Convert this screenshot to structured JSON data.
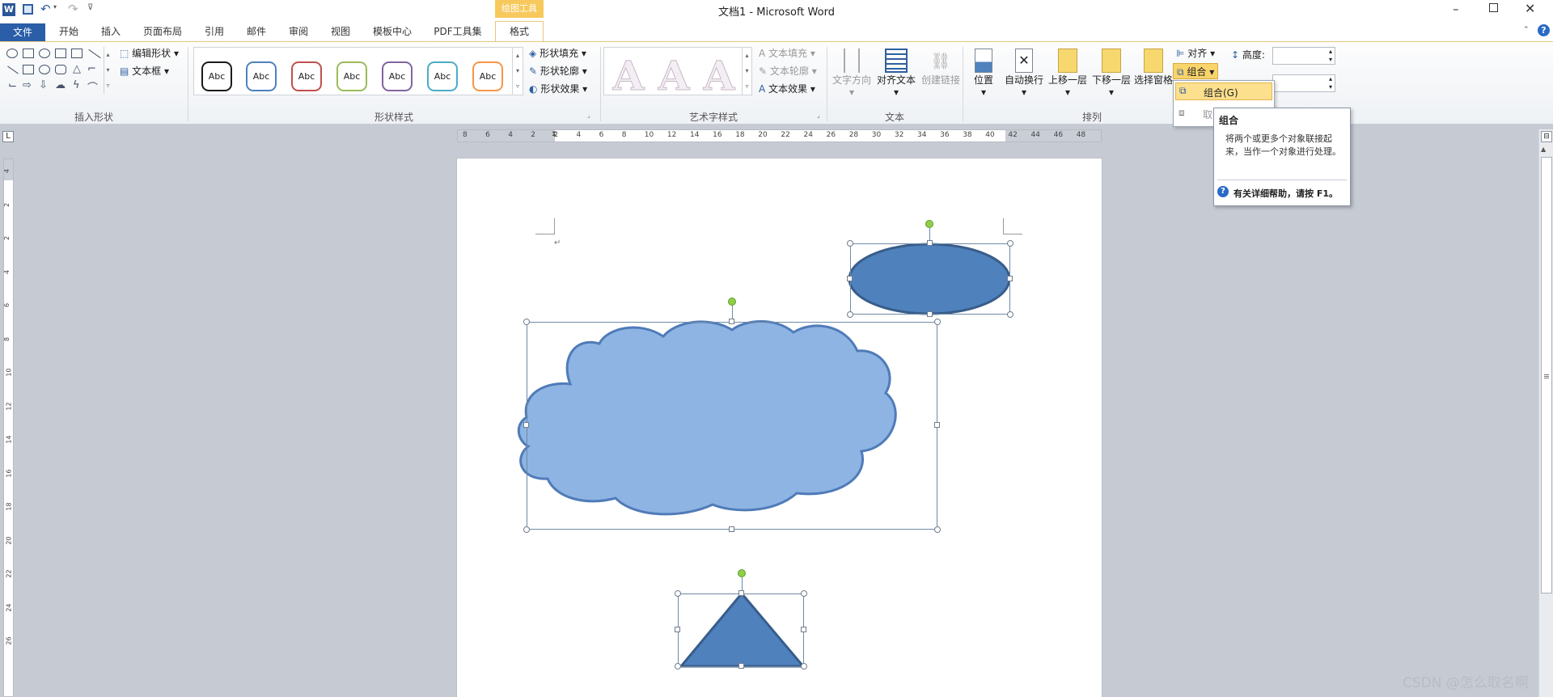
{
  "app": {
    "title": "文档1 - Microsoft Word",
    "contextual_group": "绘图工具"
  },
  "quick_access": {
    "icons": [
      "word-icon",
      "save-icon",
      "undo-icon",
      "redo-icon",
      "customize-icon"
    ]
  },
  "tabs": {
    "file": "文件",
    "items": [
      "开始",
      "插入",
      "页面布局",
      "引用",
      "邮件",
      "审阅",
      "视图",
      "模板中心",
      "PDF工具集"
    ],
    "active": "格式"
  },
  "ribbon": {
    "insert_shapes": {
      "label": "插入形状",
      "edit_shape": "编辑形状",
      "text_box": "文本框"
    },
    "shape_styles": {
      "label": "形状样式",
      "sample": "Abc",
      "fill": "形状填充",
      "outline": "形状轮廓",
      "effects": "形状效果",
      "swatches": [
        "#1a1a1a",
        "#4f81bd",
        "#c0504d",
        "#9bbb59",
        "#8064a2",
        "#4bacc6",
        "#f79646"
      ]
    },
    "wordart": {
      "label": "艺术字样式",
      "glyph": "A",
      "text_fill": "文本填充",
      "text_outline": "文本轮廓",
      "text_effects": "文本效果"
    },
    "text": {
      "label": "文本",
      "direction": "文字方向",
      "align": "对齐文本",
      "link": "创建链接"
    },
    "arrange": {
      "label": "排列",
      "position": "位置",
      "wrap": "自动换行",
      "bring_forward": "上移一层",
      "send_backward": "下移一层",
      "selection_pane": "选择窗格",
      "align": "对齐",
      "group": "组合"
    },
    "size": {
      "height_label": "高度:"
    }
  },
  "dropdown": {
    "group_item": "组合(G)",
    "ungroup_item": "取消组合"
  },
  "tooltip": {
    "title": "组合",
    "body": "将两个或更多个对象联接起来，当作一个对象进行处理。",
    "help": "有关详细帮助，请按 F1。"
  },
  "ruler": {
    "h_ticks": [
      "8",
      "6",
      "4",
      "2",
      "2",
      "4",
      "6",
      "8",
      "10",
      "12",
      "14",
      "16",
      "18",
      "20",
      "22",
      "24",
      "26",
      "28",
      "30",
      "32",
      "34",
      "36",
      "38",
      "40",
      "42",
      "44",
      "46",
      "48"
    ],
    "v_ticks": [
      "4",
      "2",
      "2",
      "4",
      "6",
      "8",
      "10",
      "12",
      "14",
      "16",
      "18",
      "20",
      "22",
      "24",
      "26"
    ]
  },
  "document": {
    "paragraph_mark": "↵",
    "colors": {
      "ellipse": "#4f81bd",
      "cloud": "#8eb4e3",
      "triangle": "#4f81bd",
      "outline": "#385d8a"
    }
  },
  "watermark": "CSDN @怎么取名啊"
}
